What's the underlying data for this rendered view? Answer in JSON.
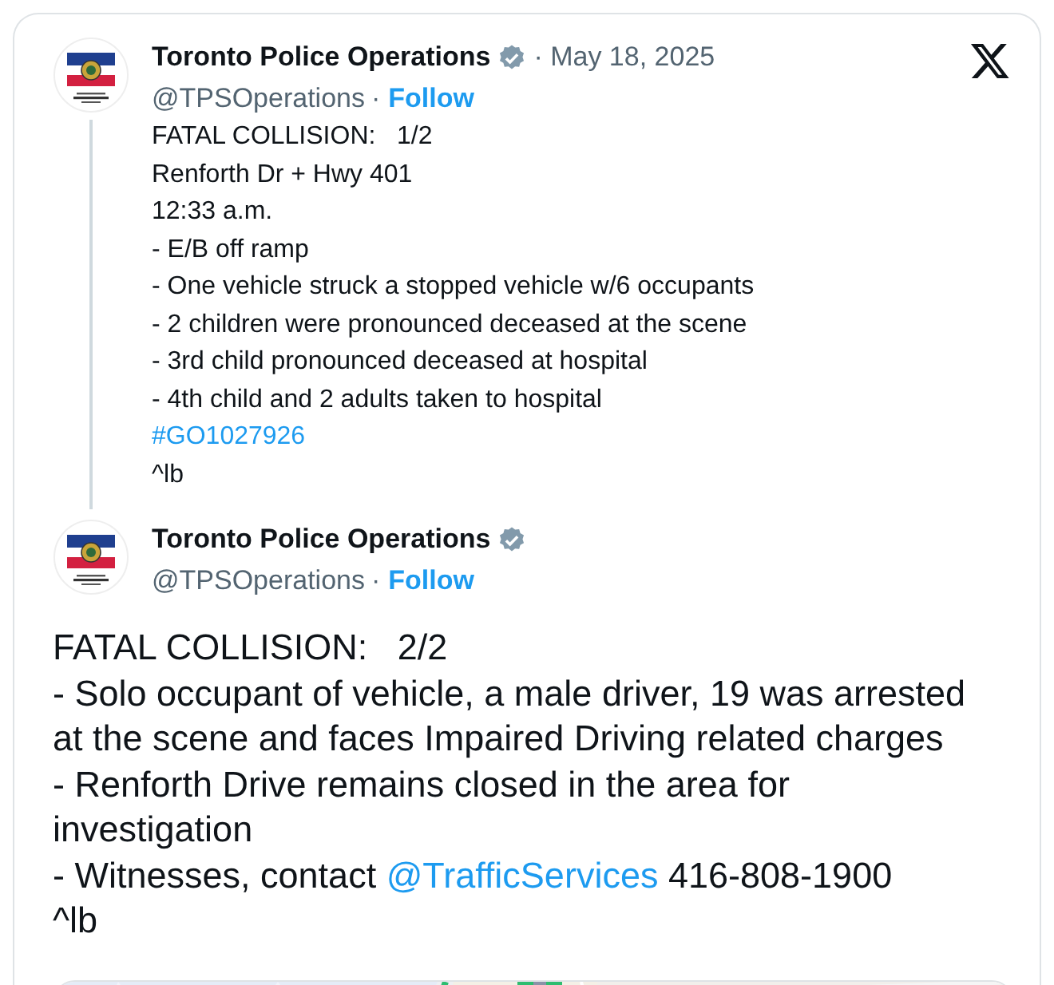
{
  "posts": [
    {
      "author": "Toronto Police Operations",
      "verified": true,
      "handle": "@TPSOperations",
      "date": "· May 18, 2025",
      "separator": "·",
      "follow": "Follow",
      "kind": "thread-top",
      "lines": [
        {
          "text": "FATAL COLLISION:   1/2"
        },
        {
          "text": "Renforth Dr + Hwy 401"
        },
        {
          "text": "12:33 a.m."
        },
        {
          "text": "- E/B off ramp"
        },
        {
          "text": "- One vehicle struck a stopped vehicle w/6 occupants"
        },
        {
          "text": "- 2 children were pronounced deceased at the scene"
        },
        {
          "text": "- 3rd child pronounced deceased at hospital"
        },
        {
          "text": "- 4th child and 2 adults taken to hospital"
        },
        {
          "text": "#GO1027926",
          "kind": "hashtag"
        },
        {
          "text": "^lb"
        }
      ]
    },
    {
      "author": "Toronto Police Operations",
      "verified": true,
      "handle": "@TPSOperations",
      "separator": "·",
      "follow": "Follow",
      "kind": "main",
      "lines": [
        {
          "text": "FATAL COLLISION:   2/2"
        },
        {
          "text": "- Solo occupant of vehicle, a male driver, 19 was arrested at the scene and faces Impaired Driving related charges"
        },
        {
          "text": "- Renforth Drive remains closed in the area for investigation"
        },
        {
          "parts": [
            {
              "text": "- Witnesses, contact "
            },
            {
              "text": "@TrafficServices",
              "kind": "mention"
            },
            {
              "text": " 416-808-1900"
            }
          ]
        },
        {
          "text": "^lb"
        }
      ]
    }
  ]
}
